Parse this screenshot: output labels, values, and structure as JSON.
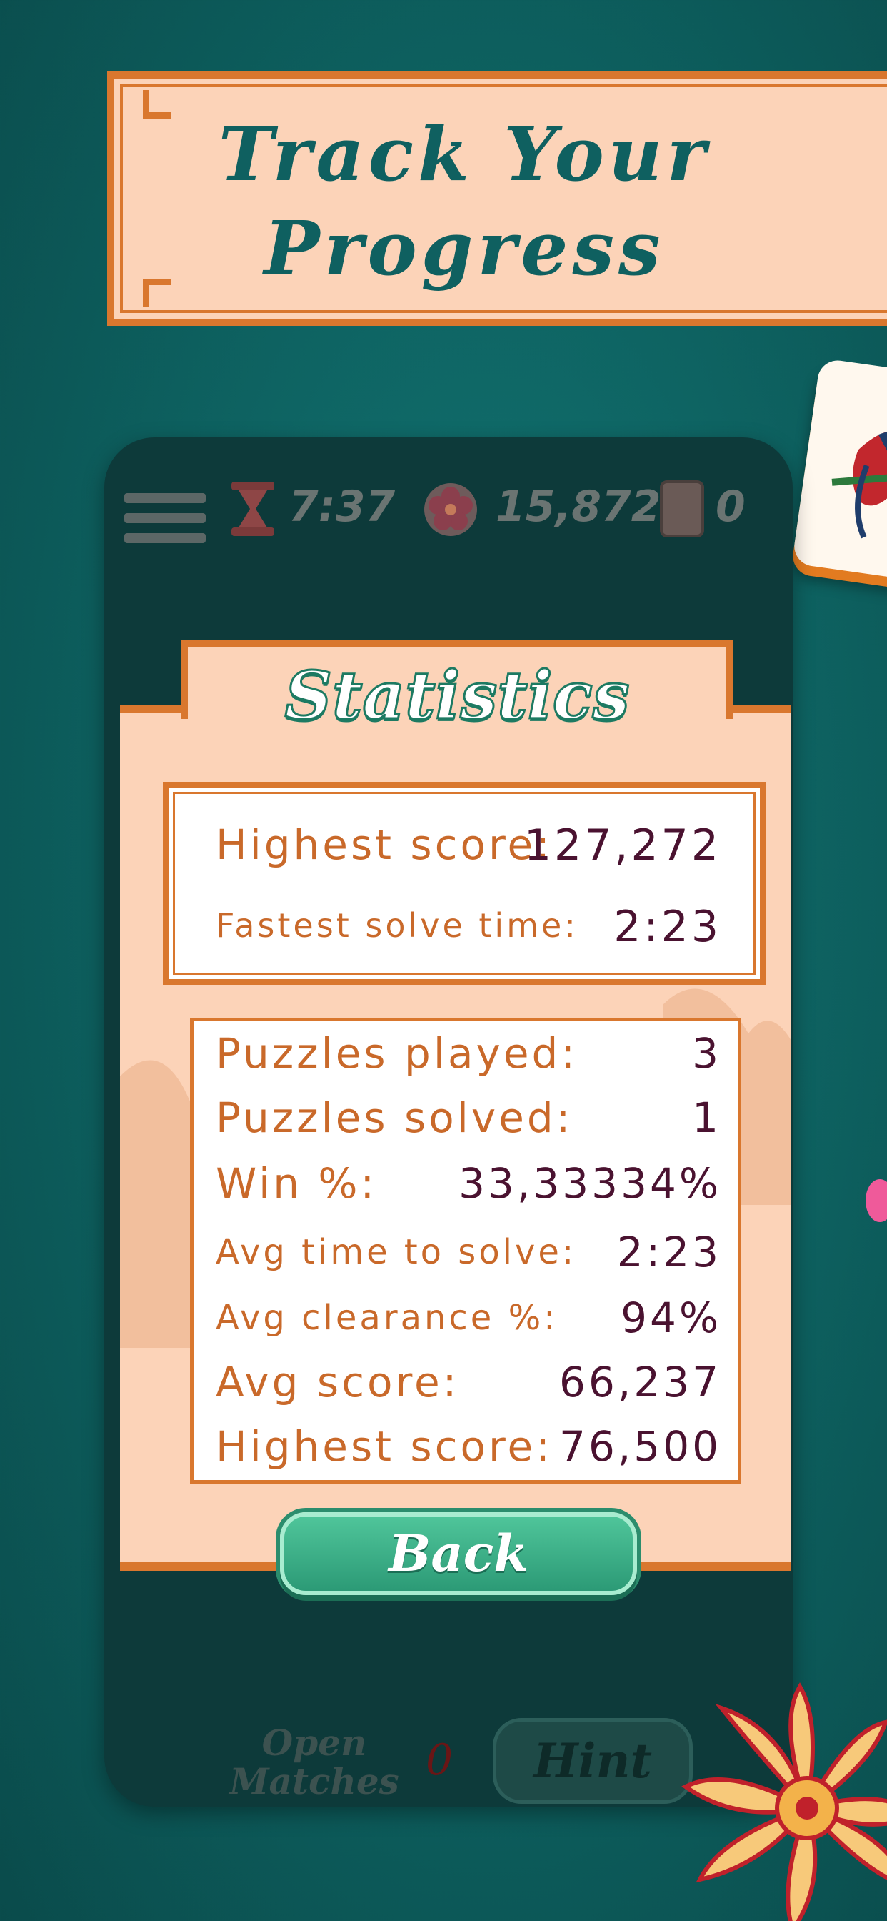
{
  "banner": {
    "title": "Track Your Progress"
  },
  "hud": {
    "timer": "7:37",
    "score": "15,872",
    "tiles_count": "0"
  },
  "stats": {
    "title": "Statistics",
    "best": [
      {
        "label": "Highest score:",
        "value": "127,272"
      },
      {
        "label": "Fastest solve time:",
        "value": "2:23"
      }
    ],
    "details": [
      {
        "label": "Puzzles played:",
        "value": "3"
      },
      {
        "label": "Puzzles solved:",
        "value": "1"
      },
      {
        "label": "Win %:",
        "value": "33,33334%"
      },
      {
        "label": "Avg time to solve:",
        "value": "2:23"
      },
      {
        "label": "Avg clearance %:",
        "value": "94%"
      },
      {
        "label": "Avg score:",
        "value": "66,237"
      },
      {
        "label": "Highest score:",
        "value": "76,500"
      }
    ]
  },
  "buttons": {
    "back": "Back",
    "hint": "Hint"
  },
  "bottom": {
    "open_matches_label": "Open Matches",
    "open_matches_count": "0"
  },
  "colors": {
    "accent_orange": "#d9772e",
    "panel": "#fcd3b8",
    "background": "#0d5f5e",
    "button_green": "#2c9a76"
  },
  "icons": [
    "menu-icon",
    "hourglass-icon",
    "flower-icon",
    "tile-icon",
    "bird-tile-icon",
    "chrysanthemum-icon"
  ]
}
